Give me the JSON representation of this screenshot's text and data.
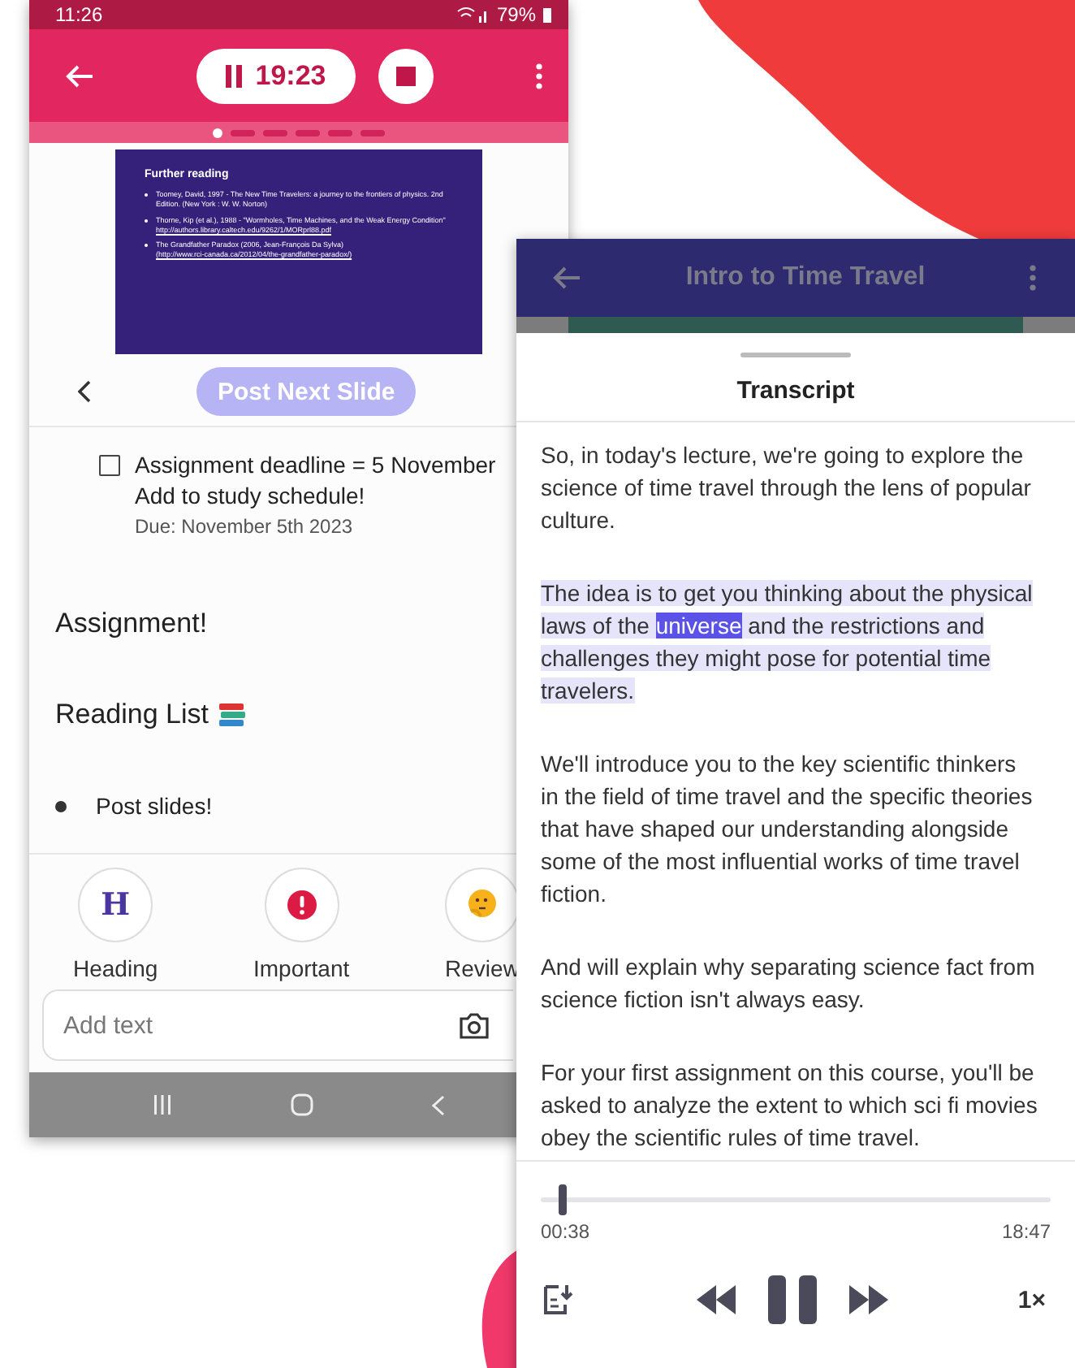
{
  "notes_phone": {
    "status_bar": {
      "time": "11:26",
      "battery": "79%"
    },
    "recorder": {
      "paused": true,
      "elapsed": "19:23"
    },
    "slide_dots": [
      {
        "selected": true
      },
      {
        "selected": false
      },
      {
        "selected": false
      },
      {
        "selected": false
      },
      {
        "selected": false
      },
      {
        "selected": false
      }
    ],
    "slide": {
      "title": "Further reading",
      "items": [
        {
          "text": "Toomey, David, 1997 - The New Time Travelers: a journey to the frontiers of physics. 2nd Edition. (New York : W. W. Norton)"
        },
        {
          "text": "Thorne, Kip (et al.), 1988 - \"Wormholes, Time Machines, and the Weak Energy Condition\"",
          "link": "http://authors.library.caltech.edu/9262/1/MORprl88.pdf"
        },
        {
          "text": "The Grandfather Paradox (2006, Jean-François Da Sylva)",
          "link": "(http://www.rci-canada.ca/2012/04/the-grandfather-paradox/)"
        }
      ]
    },
    "post_button": {
      "label": "Post Next Slide",
      "disabled": true
    },
    "notes": [
      {
        "kind": "task",
        "checked": false,
        "title": "Assignment deadline = 5 November",
        "text": "Add to study schedule!",
        "due": "Due: November 5th 2023"
      },
      {
        "kind": "heading",
        "text": "Assignment!"
      },
      {
        "kind": "heading_books",
        "text": "Reading List"
      },
      {
        "kind": "bullet",
        "text": "Post slides!"
      }
    ],
    "tools": [
      {
        "kind": "heading",
        "glyph": "H",
        "label": "Heading"
      },
      {
        "kind": "important",
        "label": "Important"
      },
      {
        "kind": "review",
        "label": "Review"
      }
    ],
    "input": {
      "placeholder": "Add text"
    }
  },
  "transcript_phone": {
    "title": "Intro to Time Travel",
    "sheet_title": "Transcript",
    "paragraphs": [
      {
        "highlighted": false,
        "parts": [
          {
            "text": "So, in today's lecture, we're going to explore the science of time travel through the lens of popular culture.",
            "current": false
          }
        ]
      },
      {
        "highlighted": true,
        "parts": [
          {
            "text": "The idea is to get you thinking about the physical laws of the ",
            "current": false
          },
          {
            "text": "universe",
            "current": true
          },
          {
            "text": " and the restrictions and challenges they might pose for potential time travelers.",
            "current": false
          }
        ]
      },
      {
        "highlighted": false,
        "parts": [
          {
            "text": "We'll introduce you to the key scientific thinkers in the field of time travel and the specific theories that have shaped our understanding alongside some of the most influential works of time travel fiction.",
            "current": false
          }
        ]
      },
      {
        "highlighted": false,
        "parts": [
          {
            "text": "And will explain why separating science fact from science fiction isn't always easy.",
            "current": false
          }
        ]
      },
      {
        "highlighted": false,
        "parts": [
          {
            "text": "For your first assignment on this course, you'll be asked to analyze the extent to which sci fi movies obey the scientific rules of time travel.",
            "current": false
          }
        ]
      }
    ],
    "player": {
      "level": 0.035,
      "position": "00:38",
      "duration": "18:47",
      "playing": true,
      "speed": "1×"
    }
  }
}
